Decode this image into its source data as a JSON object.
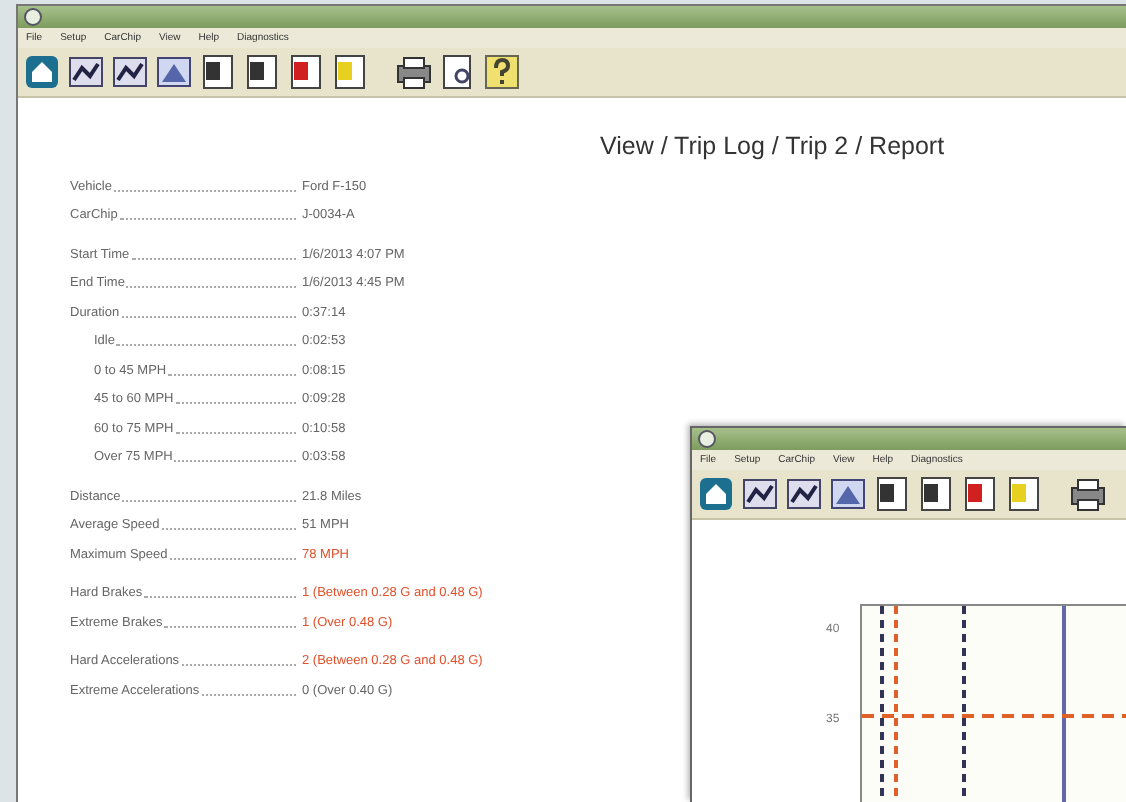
{
  "main_window": {
    "menu": [
      "File",
      "Setup",
      "CarChip",
      "View",
      "Help",
      "Diagnostics"
    ]
  },
  "heading": "View / Trip Log / Trip 2 / Report",
  "report": {
    "groups": [
      {
        "rows": [
          {
            "label": "Vehicle",
            "value": "Ford F-150",
            "highlight": false
          },
          {
            "label": "CarChip",
            "value": "J-0034-A",
            "highlight": false
          }
        ]
      },
      {
        "rows": [
          {
            "label": "Start Time",
            "value": "1/6/2013 4:07 PM",
            "highlight": false
          },
          {
            "label": "End Time",
            "value": "1/6/2013 4:45 PM",
            "highlight": false
          },
          {
            "label": "Duration",
            "value": "0:37:14",
            "highlight": false,
            "children": [
              {
                "label": "Idle",
                "value": "0:02:53",
                "highlight": false
              },
              {
                "label": "0 to 45 MPH",
                "value": "0:08:15",
                "highlight": false
              },
              {
                "label": "45 to 60 MPH",
                "value": "0:09:28",
                "highlight": false
              },
              {
                "label": "60 to 75 MPH",
                "value": "0:10:58",
                "highlight": false
              },
              {
                "label": "Over 75 MPH",
                "value": "0:03:58",
                "highlight": false
              }
            ]
          }
        ]
      },
      {
        "rows": [
          {
            "label": "Distance",
            "value": "21.8 Miles",
            "highlight": false
          },
          {
            "label": "Average Speed",
            "value": "51 MPH",
            "highlight": false
          },
          {
            "label": "Maximum Speed",
            "value": "78 MPH",
            "highlight": true
          }
        ]
      },
      {
        "rows": [
          {
            "label": "Hard Brakes",
            "value": "1 (Between 0.28 G and 0.48 G)",
            "highlight": true
          },
          {
            "label": "Extreme Brakes",
            "value": "1 (Over 0.48 G)",
            "highlight": true
          }
        ]
      },
      {
        "rows": [
          {
            "label": "Hard Accelerations",
            "value": "2 (Between 0.28 G and 0.48 G)",
            "highlight": true
          },
          {
            "label": "Extreme Accelerations",
            "value": "0 (Over 0.40 G)",
            "highlight": false
          }
        ]
      }
    ]
  },
  "second_window": {
    "menu": [
      "File",
      "Setup",
      "CarChip",
      "View",
      "Help",
      "Diagnostics"
    ],
    "y_tick_labels": [
      "40",
      "35"
    ]
  }
}
